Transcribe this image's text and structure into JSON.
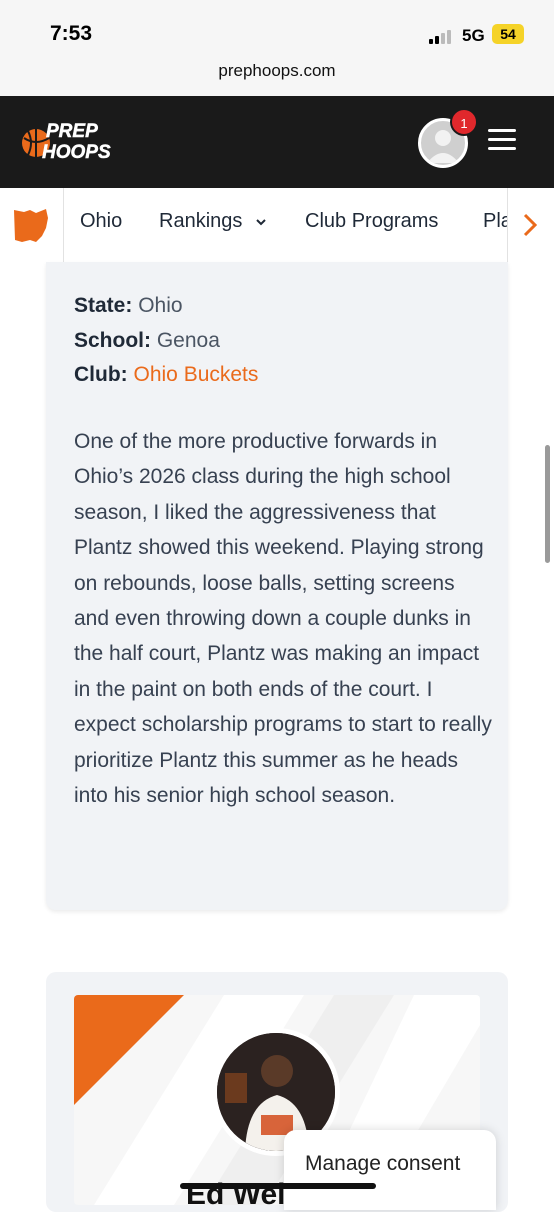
{
  "status_bar": {
    "time": "7:53",
    "network": "5G",
    "battery": "54"
  },
  "browser": {
    "url": "prephoops.com"
  },
  "header": {
    "logo_line1": "PREP",
    "logo_line2": "HOOPS",
    "notification_count": "1",
    "brand_color": "#ea6a1b"
  },
  "sub_nav": {
    "items": [
      {
        "label": "Ohio"
      },
      {
        "label": "Rankings"
      },
      {
        "label": "Club Programs"
      },
      {
        "label": "Pla"
      }
    ]
  },
  "profile": {
    "state_label": "State:",
    "state_value": "Ohio",
    "school_label": "School:",
    "school_value": "Genoa",
    "club_label": "Club:",
    "club_value": "Ohio Buckets",
    "bio": "One of the more productive forwards in Ohio’s 2026 class during the high school season, I liked the aggressiveness that Plantz showed this weekend. Playing strong on rebounds, loose balls, setting screens and even throwing down a couple dunks in the half court, Plantz was making an impact in the paint on both ends of the court. I expect scholarship programs to start to really prioritize Plantz this summer as he heads into his senior high school season."
  },
  "next_player": {
    "name": "Ed Wel"
  },
  "consent": {
    "label": "Manage consent"
  }
}
